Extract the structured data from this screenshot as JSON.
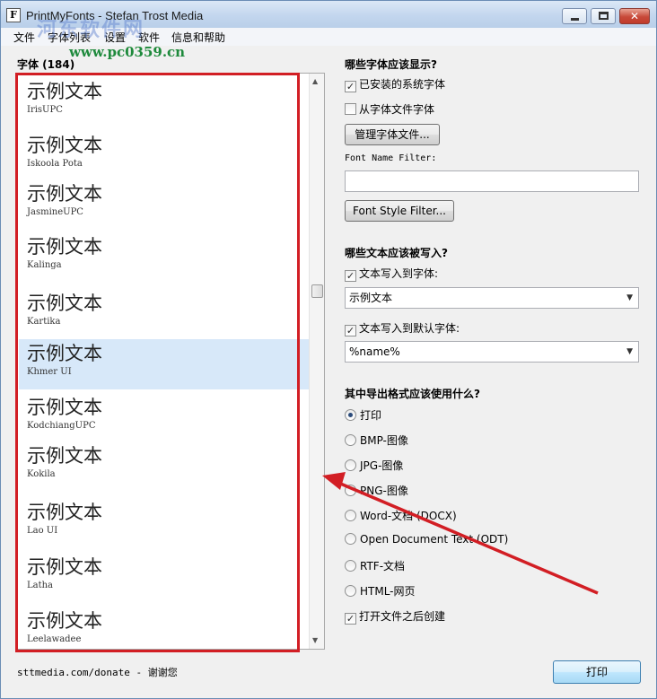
{
  "window": {
    "title": "PrintMyFonts - Stefan Trost Media"
  },
  "watermark": {
    "text": "河东软件网",
    "url": "www.pc0359.cn"
  },
  "menu": [
    "文件",
    "字体列表",
    "设置",
    "软件",
    "信息和帮助"
  ],
  "font_list": {
    "title": "字体 (184)",
    "items": [
      {
        "sample": "示例文本",
        "name": "IrisUPC"
      },
      {
        "sample": "示例文本",
        "name": "Iskoola Pota"
      },
      {
        "sample": "示例文本",
        "name": "JasmineUPC"
      },
      {
        "sample": "示例文本",
        "name": "Kalinga"
      },
      {
        "sample": "示例文本",
        "name": "Kartika"
      },
      {
        "sample": "示例文本",
        "name": "Khmer UI",
        "selected": true
      },
      {
        "sample": "示例文本",
        "name": "KodchiangUPC"
      },
      {
        "sample": "示例文本",
        "name": "Kokila"
      },
      {
        "sample": "示例文本",
        "name": "Lao UI"
      },
      {
        "sample": "示例文本",
        "name": "Latha"
      },
      {
        "sample": "示例文本",
        "name": "Leelawadee"
      }
    ]
  },
  "fonts_section": {
    "title": "哪些字体应该显示?",
    "installed_label": "已安装的系统字体",
    "installed_checked": true,
    "from_files_label": "从字体文件字体",
    "from_files_checked": false,
    "manage_button": "管理字体文件...",
    "name_filter_label": "Font Name Filter:",
    "name_filter_value": "",
    "style_filter_button": "Font Style Filter..."
  },
  "text_section": {
    "title": "哪些文本应该被写入?",
    "write_text_label": "文本写入到字体:",
    "write_text_checked": true,
    "write_text_value": "示例文本",
    "write_default_label": "文本写入到默认字体:",
    "write_default_checked": true,
    "write_default_value": "%name%"
  },
  "export_section": {
    "title": "其中导出格式应该使用什么?",
    "options": [
      "打印",
      "BMP-图像",
      "JPG-图像",
      "PNG-图像",
      "Word-文档 (DOCX)",
      "Open Document Text (ODT)",
      "RTF-文档",
      "HTML-网页"
    ],
    "selected_index": 0,
    "open_after_label": "打开文件之后创建",
    "open_after_checked": true
  },
  "footer": {
    "donate_text": "sttmedia.com/donate - 谢谢您",
    "print_button": "打印"
  },
  "colors": {
    "annotation_red": "#d21e24",
    "selection": "#d7e8f9"
  }
}
